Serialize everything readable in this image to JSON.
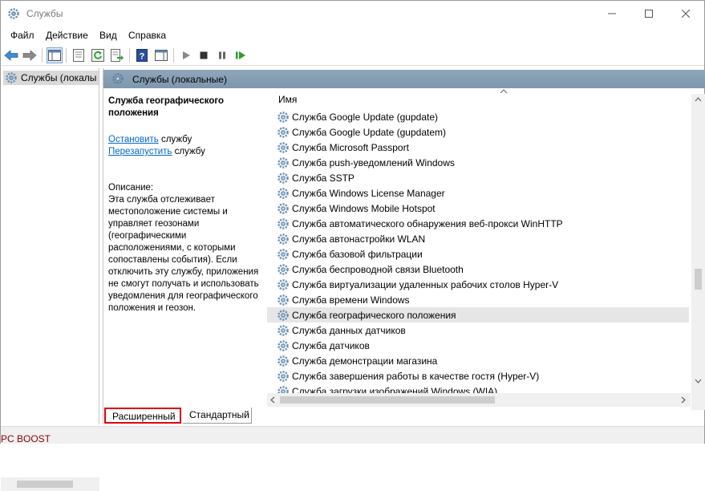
{
  "window": {
    "title": "Службы",
    "icon": "gear-icon"
  },
  "menu": [
    "Файл",
    "Действие",
    "Вид",
    "Справка"
  ],
  "tree": {
    "item_label": "Службы (локалы"
  },
  "main": {
    "header": "Службы (локальные)",
    "desc_title": "Служба географического положения",
    "stop_link": "Остановить",
    "stop_rest": " службу",
    "restart_link": "Перезапустить",
    "restart_rest": " службу",
    "desc_label": "Описание:",
    "desc_text": "Эта служба отслеживает местоположение системы и управляет геозонами (географическими расположениями, с которыми сопоставлены события). Если отключить эту службу, приложения не смогут получать и использовать уведомления для географического положения и геозон."
  },
  "list": {
    "column_name": "Имя",
    "rows": [
      "Служба Google Update (gupdate)",
      "Служба Google Update (gupdatem)",
      "Служба Microsoft Passport",
      "Служба push-уведомлений Windows",
      "Служба SSTP",
      "Служба Windows License Manager",
      "Служба Windows Mobile Hotspot",
      "Служба автоматического обнаружения веб-прокси WinHTTP",
      "Служба автонастройки WLAN",
      "Служба базовой фильтрации",
      "Служба беспроводной связи Bluetooth",
      "Служба виртуализации удаленных рабочих столов Hyper-V",
      "Служба времени Windows",
      "Служба географического положения",
      "Служба данных датчиков",
      "Служба датчиков",
      "Служба демонстрации магазина",
      "Служба завершения работы в качестве гостя (Hyper-V)",
      "Служба загрузки изображений Windows (WIA)"
    ],
    "selected_index": 13
  },
  "tabs": {
    "extended": "Расширенный",
    "standard": "Стандартный"
  },
  "status": {
    "text": "PC BOOST"
  },
  "colors": {
    "header_bg": "#8fa6bb",
    "link": "#0066cc",
    "active_tab_border": "#e0000f",
    "status_text": "#8b0000"
  }
}
